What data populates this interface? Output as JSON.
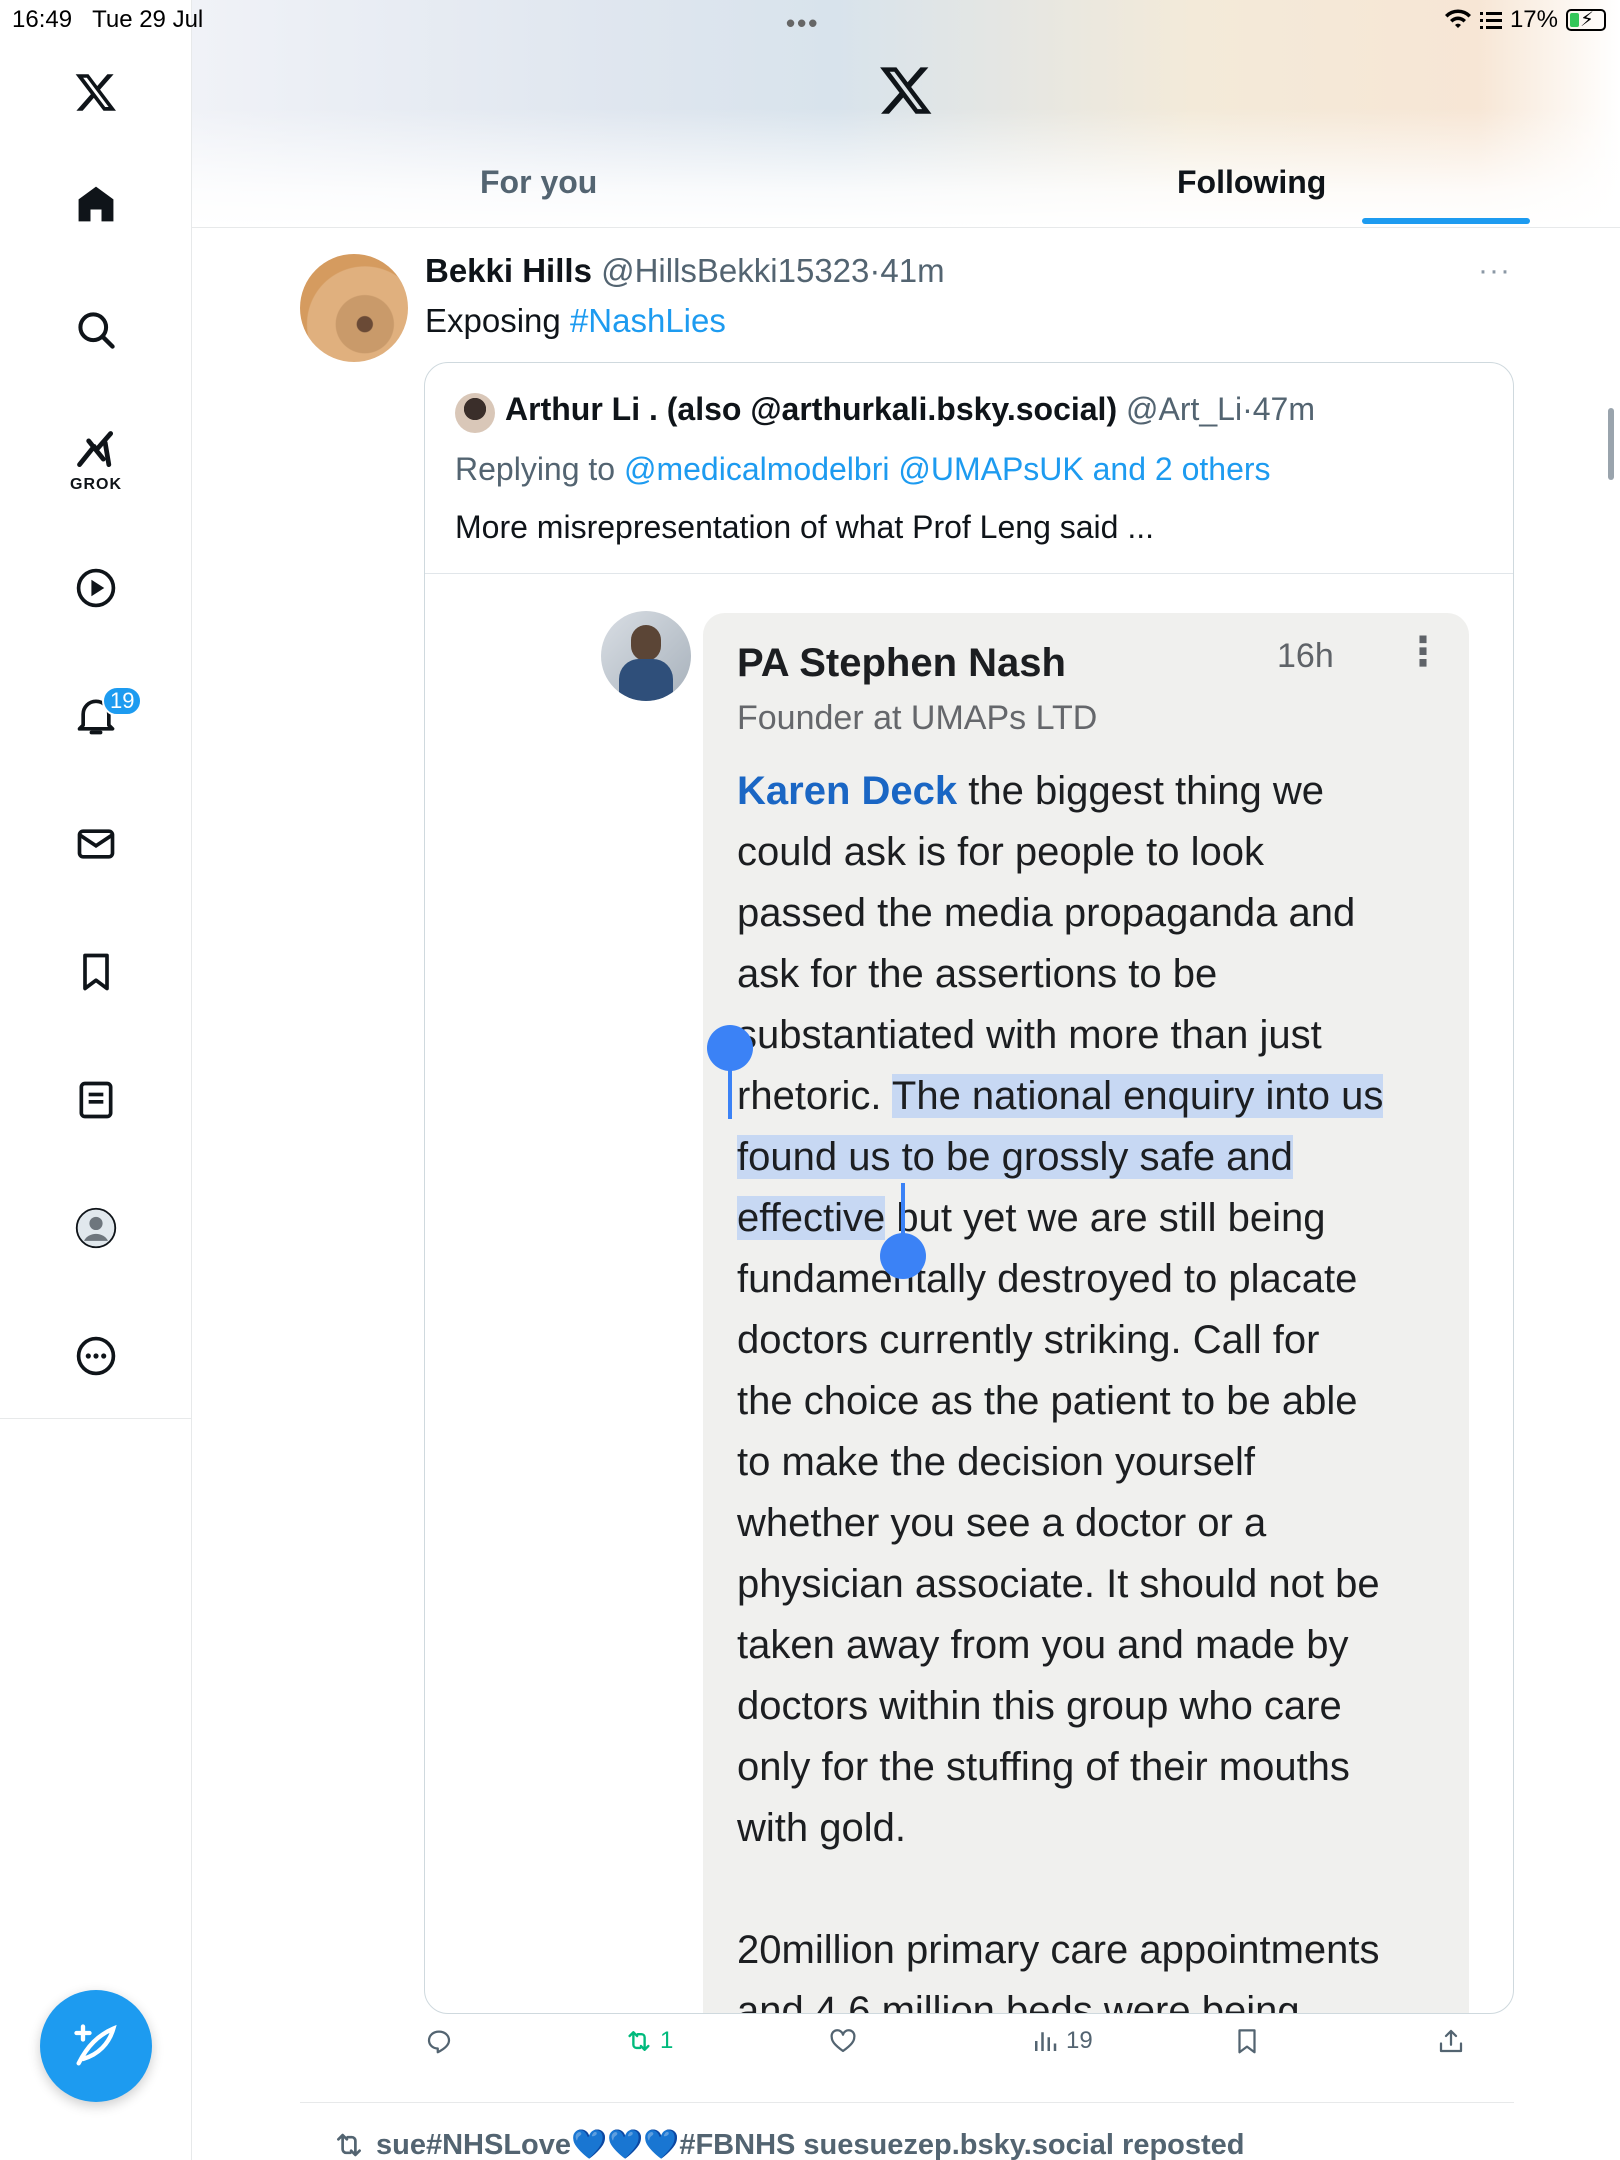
{
  "status_bar": {
    "time": "16:49",
    "date": "Tue 29 Jul",
    "battery": "17%",
    "handle_dots": "•••"
  },
  "sidebar": {
    "items": [
      {
        "icon": "x-logo-icon",
        "label": ""
      },
      {
        "icon": "home-icon",
        "label": ""
      },
      {
        "icon": "search-icon",
        "label": ""
      },
      {
        "icon": "grok-icon",
        "label": "GROK"
      },
      {
        "icon": "play-icon",
        "label": ""
      },
      {
        "icon": "bell-icon",
        "label": ""
      },
      {
        "icon": "mail-icon",
        "label": ""
      },
      {
        "icon": "bookmark-icon",
        "label": ""
      },
      {
        "icon": "list-icon",
        "label": ""
      },
      {
        "icon": "profile-icon",
        "label": ""
      },
      {
        "icon": "more-icon",
        "label": ""
      }
    ],
    "notification_count": "19"
  },
  "header": {
    "tabs": [
      {
        "label": "For you",
        "active": false
      },
      {
        "label": "Following",
        "active": true
      }
    ]
  },
  "tweet": {
    "author_name": "Bekki Hills",
    "author_handle": "@HillsBekki15323",
    "separator": "·",
    "time": "41m",
    "text_prefix": "Exposing ",
    "hashtag": "#NashLies",
    "more": "···",
    "quote": {
      "author_name": "Arthur Li . (also @arthurkali.bsky.social)",
      "author_handle": "@Art_Li",
      "separator": "·",
      "time": "47m",
      "replying_prefix": "Replying to ",
      "replying_links": "@medicalmodelbri @UMAPsUK and 2 others",
      "text": "More misrepresentation of what Prof Leng said ..."
    },
    "embedded_comment": {
      "name": "PA Stephen Nash",
      "time": "16h",
      "kebab": "⋮",
      "subtitle": "Founder at UMAPs LTD",
      "mention": "Karen Deck",
      "line1_rest": " the biggest thing we",
      "lines_before_selection": [
        "could ask is for people to look",
        "passed the media propaganda and",
        "ask for the assertions to be",
        "substantiated with more than just"
      ],
      "line6_before": "rhetoric. ",
      "line6_selected": "The national enquiry into us",
      "line7_selected": "found us to be grossly safe and",
      "line8_selected": "effective",
      "line8_after": " but yet we are still being",
      "lines_after_selection": [
        "fundamentally destroyed to placate",
        "doctors currently striking. Call for",
        "the choice as the patient to be able",
        "to make the decision yourself",
        "whether you see a doctor or a",
        "physician associate. It should not be",
        "taken away from you and made by",
        "doctors within this group who care",
        "only for the stuffing of their mouths",
        "with gold."
      ],
      "paragraph2_lines": [
        "20million primary care appointments",
        "and 4.6 million beds were being"
      ]
    },
    "actions": {
      "reply_count": "",
      "repost_count": "1",
      "like_count": "",
      "views_count": "19"
    }
  },
  "next_item": {
    "repost_text": "sue#NHSLove💙💙💙#FBNHS suesuezep.bsky.social reposted"
  },
  "colors": {
    "accent": "#1d9bf0",
    "repost_green": "#00ba7c",
    "selection": "#c7d8f3",
    "handle": "#3b82f6",
    "fb_link": "#1a66c4"
  }
}
